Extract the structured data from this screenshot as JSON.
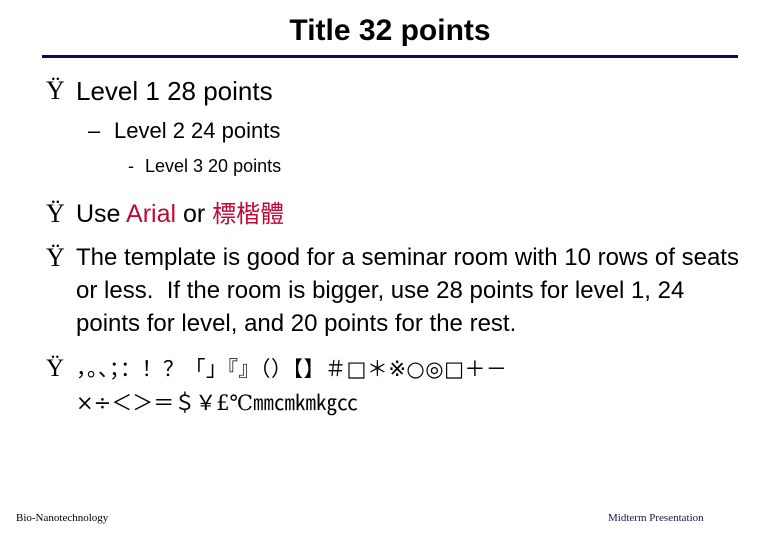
{
  "slide": {
    "title": "Title 32 points",
    "rule_color": "#0a0a56",
    "accent_color": "#bf0a35"
  },
  "bullets": {
    "level1_mark": "Ÿ",
    "level2_mark": "–",
    "level3_mark": "-"
  },
  "content": {
    "level1": "Level 1 28 points",
    "level2": "Level 2 24 points",
    "level3": "Level 3 20 points",
    "font_line": {
      "prefix": "Use ",
      "latin_font": "Arial",
      "conjunction": " or ",
      "cjk_font": "標楷體"
    },
    "paragraph": "The template is good for a seminar room with 10 rows of seats or less.  If the room is bigger, use 28 points for level 1, 24 points for level, and 20 points for the rest.",
    "symbols_line1": "，。、；：！？「」『』（）【】＃□＊※○◎□＋－",
    "symbols_line2": "×÷＜＞＝＄￥£℃㎜㎝㎞㎏㏄"
  },
  "footer": {
    "left": "Bio-Nanotechnology",
    "right": "Midterm Presentation"
  }
}
